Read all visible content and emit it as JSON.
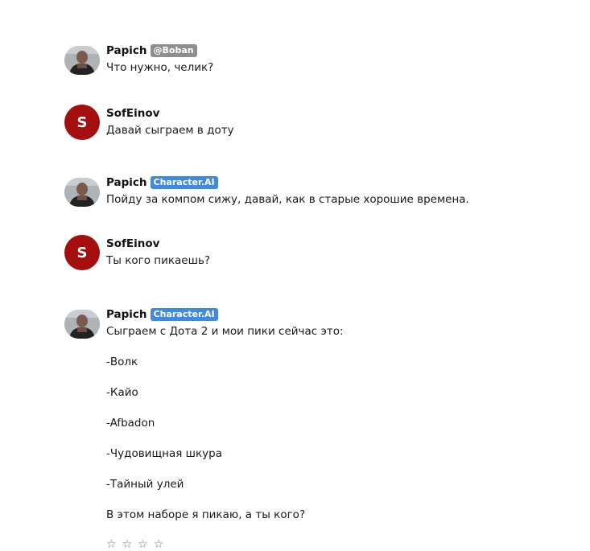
{
  "messages": [
    {
      "author": "Papich",
      "badge": "@Boban",
      "text": "Что нужно, челик?"
    },
    {
      "author": "SofEinov",
      "avatar_letter": "S",
      "text": "Давай сыграем в доту"
    },
    {
      "author": "Papich",
      "badge": "Character.AI",
      "text": "Пойду за компом сижу, давай, как в старые хорошие времена."
    },
    {
      "author": "SofEinov",
      "avatar_letter": "S",
      "text": "Ты кого пикаешь?"
    },
    {
      "author": "Papich",
      "badge": "Character.AI",
      "lines": [
        "Сыграем с Дота 2 и мои пики сейчас это:",
        "-Волк",
        "-Кайо",
        "-Afbadon",
        "-Чудовищная шкура",
        "-Тайный улей",
        "В этом наборе я пикаю, а ты кого?"
      ]
    }
  ],
  "rating": {
    "stars": [
      "☆",
      "☆",
      "☆",
      "☆"
    ]
  },
  "colors": {
    "user_avatar": "#a50e0e",
    "badge_blue": "#3d8ae0",
    "badge_gray": "#8e8e8e"
  }
}
